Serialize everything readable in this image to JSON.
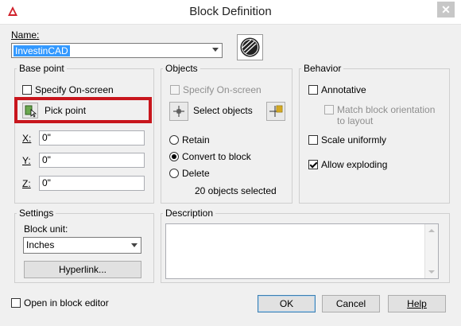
{
  "window": {
    "title": "Block Definition",
    "close_label": "✕"
  },
  "name": {
    "label": "Name:",
    "value": "InvestinCAD"
  },
  "base_point": {
    "title": "Base point",
    "specify_on_screen": "Specify On-screen",
    "pick_point": "Pick point",
    "x_label": "X:",
    "x_value": "0\"",
    "y_label": "Y:",
    "y_value": "0\"",
    "z_label": "Z:",
    "z_value": "0\""
  },
  "objects": {
    "title": "Objects",
    "specify_on_screen": "Specify On-screen",
    "select_objects": "Select objects",
    "retain": "Retain",
    "convert_to_block": "Convert to block",
    "delete": "Delete",
    "status": "20 objects selected"
  },
  "behavior": {
    "title": "Behavior",
    "annotative": "Annotative",
    "match_line1": "Match block orientation",
    "match_line2": "to layout",
    "scale_uniformly": "Scale uniformly",
    "allow_exploding": "Allow exploding"
  },
  "settings": {
    "title": "Settings",
    "block_unit_label": "Block unit:",
    "block_unit_value": "Inches",
    "hyperlink": "Hyperlink..."
  },
  "description": {
    "title": "Description",
    "value": ""
  },
  "footer": {
    "open_in_editor": "Open in block editor",
    "ok": "OK",
    "cancel": "Cancel",
    "help": "Help"
  },
  "colors": {
    "highlight": "#c8161d",
    "selection": "#3399ff",
    "app_icon": "#d0202a"
  }
}
